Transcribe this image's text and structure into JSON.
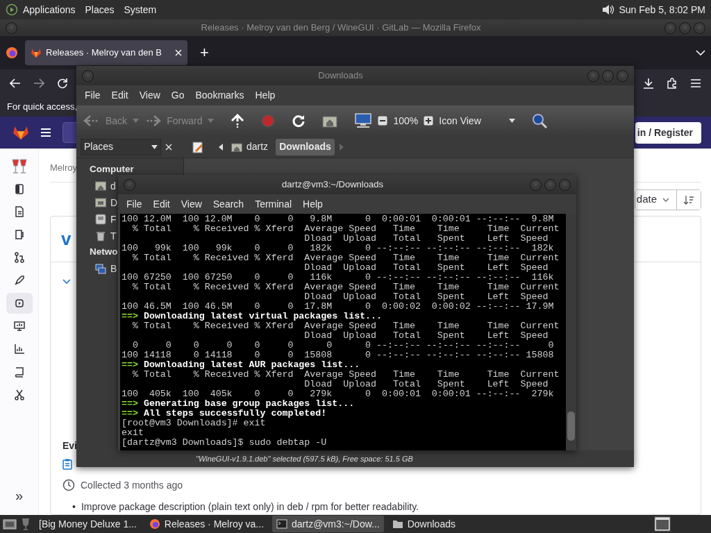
{
  "top_panel": {
    "menus": [
      "Applications",
      "Places",
      "System"
    ],
    "clock": "Sun Feb 5, 8:02 PM"
  },
  "firefox": {
    "title": "Releases · Melroy van den Berg / WineGUI · GitLab — Mozilla Firefox",
    "tabs": [
      {
        "label": "Releases · Melroy van den B",
        "selected": true
      }
    ],
    "new_tab": "+",
    "bookmarks_hint": "For quick access,",
    "gitlab": {
      "sign_in": "in / Register",
      "sidebar": [
        {
          "selected": false
        },
        {
          "selected": false
        },
        {
          "selected": false
        },
        {
          "selected": false
        },
        {
          "selected": false
        },
        {
          "selected": true
        },
        {
          "selected": false
        },
        {
          "selected": false
        },
        {
          "selected": false
        },
        {
          "selected": false
        }
      ],
      "collapse": "»",
      "breadcrumb": "Melroy",
      "sort": "date",
      "release_title": "v",
      "evidence_heading": "Evi",
      "collected": "Collected 3 months ago",
      "notes": [
        {
          "bullet": "•",
          "text": "Improve package description (plain text only) in deb / rpm for better readability."
        }
      ]
    }
  },
  "file_manager": {
    "title": "Downloads",
    "menus": [
      "File",
      "Edit",
      "View",
      "Go",
      "Bookmarks",
      "Help"
    ],
    "toolbar": {
      "back": "Back",
      "forward": "Forward",
      "zoom": "100%",
      "view": "Icon View"
    },
    "side_pane": "Places",
    "path": [
      {
        "label": "dartz",
        "selected": false
      },
      {
        "label": "Downloads",
        "selected": true
      }
    ],
    "places": [
      {
        "heading": "Computer",
        "items": [
          "d",
          "D",
          "F",
          "T"
        ]
      },
      {
        "heading": "Netwo",
        "items": [
          "B"
        ]
      }
    ],
    "status": "\"WineGUI-v1.9.1.deb\" selected (597.5 kB), Free space: 51.5 GB"
  },
  "terminal": {
    "title": "dartz@vm3:~/Downloads",
    "menus": [
      "File",
      "Edit",
      "View",
      "Search",
      "Terminal",
      "Help"
    ],
    "lines": [
      {
        "kind": "plain",
        "text": "100 12.0M  100 12.0M    0     0   9.8M      0  0:00:01  0:00:01 --:--:--  9.8M"
      },
      {
        "kind": "plain",
        "text": "  % Total    % Received % Xferd  Average Speed   Time    Time     Time  Current"
      },
      {
        "kind": "plain",
        "text": "                                 Dload  Upload   Total   Spent    Left  Speed"
      },
      {
        "kind": "plain",
        "text": "100   99k  100   99k    0     0   182k      0 --:--:-- --:--:-- --:--:--  182k"
      },
      {
        "kind": "plain",
        "text": "  % Total    % Received % Xferd  Average Speed   Time    Time     Time  Current"
      },
      {
        "kind": "plain",
        "text": "                                 Dload  Upload   Total   Spent    Left  Speed"
      },
      {
        "kind": "plain",
        "text": "100 67250  100 67250    0     0   116k      0 --:--:-- --:--:-- --:--:--  116k"
      },
      {
        "kind": "plain",
        "text": "  % Total    % Received % Xferd  Average Speed   Time    Time     Time  Current"
      },
      {
        "kind": "plain",
        "text": "                                 Dload  Upload   Total   Spent    Left  Speed"
      },
      {
        "kind": "plain",
        "text": "100 46.5M  100 46.5M    0     0  17.8M      0  0:00:02  0:00:02 --:--:-- 17.9M"
      },
      {
        "kind": "step",
        "arrow": "==>",
        "text": "Downloading latest virtual packages list..."
      },
      {
        "kind": "plain",
        "text": "  % Total    % Received % Xferd  Average Speed   Time    Time     Time  Current"
      },
      {
        "kind": "plain",
        "text": "                                 Dload  Upload   Total   Spent    Left  Speed"
      },
      {
        "kind": "plain",
        "text": "  0     0    0     0    0     0      0      0 --:--:-- --:--:-- --:--:--     0"
      },
      {
        "kind": "plain",
        "text": "100 14118    0 14118    0     0  15808      0 --:--:-- --:--:-- --:--:-- 15808"
      },
      {
        "kind": "step",
        "arrow": "==>",
        "text": "Downloading latest AUR packages list..."
      },
      {
        "kind": "plain",
        "text": "  % Total    % Received % Xferd  Average Speed   Time    Time     Time  Current"
      },
      {
        "kind": "plain",
        "text": "                                 Dload  Upload   Total   Spent    Left  Speed"
      },
      {
        "kind": "plain",
        "text": "100  405k  100  405k    0     0   279k      0  0:00:01  0:00:01 --:--:--  279k"
      },
      {
        "kind": "step",
        "arrow": "==>",
        "text": "Generating base group packages list..."
      },
      {
        "kind": "step",
        "arrow": "==>",
        "text": "All steps successfully completed!"
      },
      {
        "kind": "plain",
        "text": "[root@vm3 Downloads]# exit"
      },
      {
        "kind": "plain",
        "text": "exit"
      },
      {
        "kind": "plain",
        "text": "[dartz@vm3 Downloads]$ sudo debtap -U"
      }
    ]
  },
  "taskbar": {
    "items": [
      {
        "label": "[Big Money Deluxe 1...",
        "selected": false
      },
      {
        "label": "Releases · Melroy va...",
        "selected": false
      },
      {
        "label": "dartz@vm3:~/Dow...",
        "selected": true
      },
      {
        "label": "Downloads",
        "selected": false
      }
    ]
  }
}
